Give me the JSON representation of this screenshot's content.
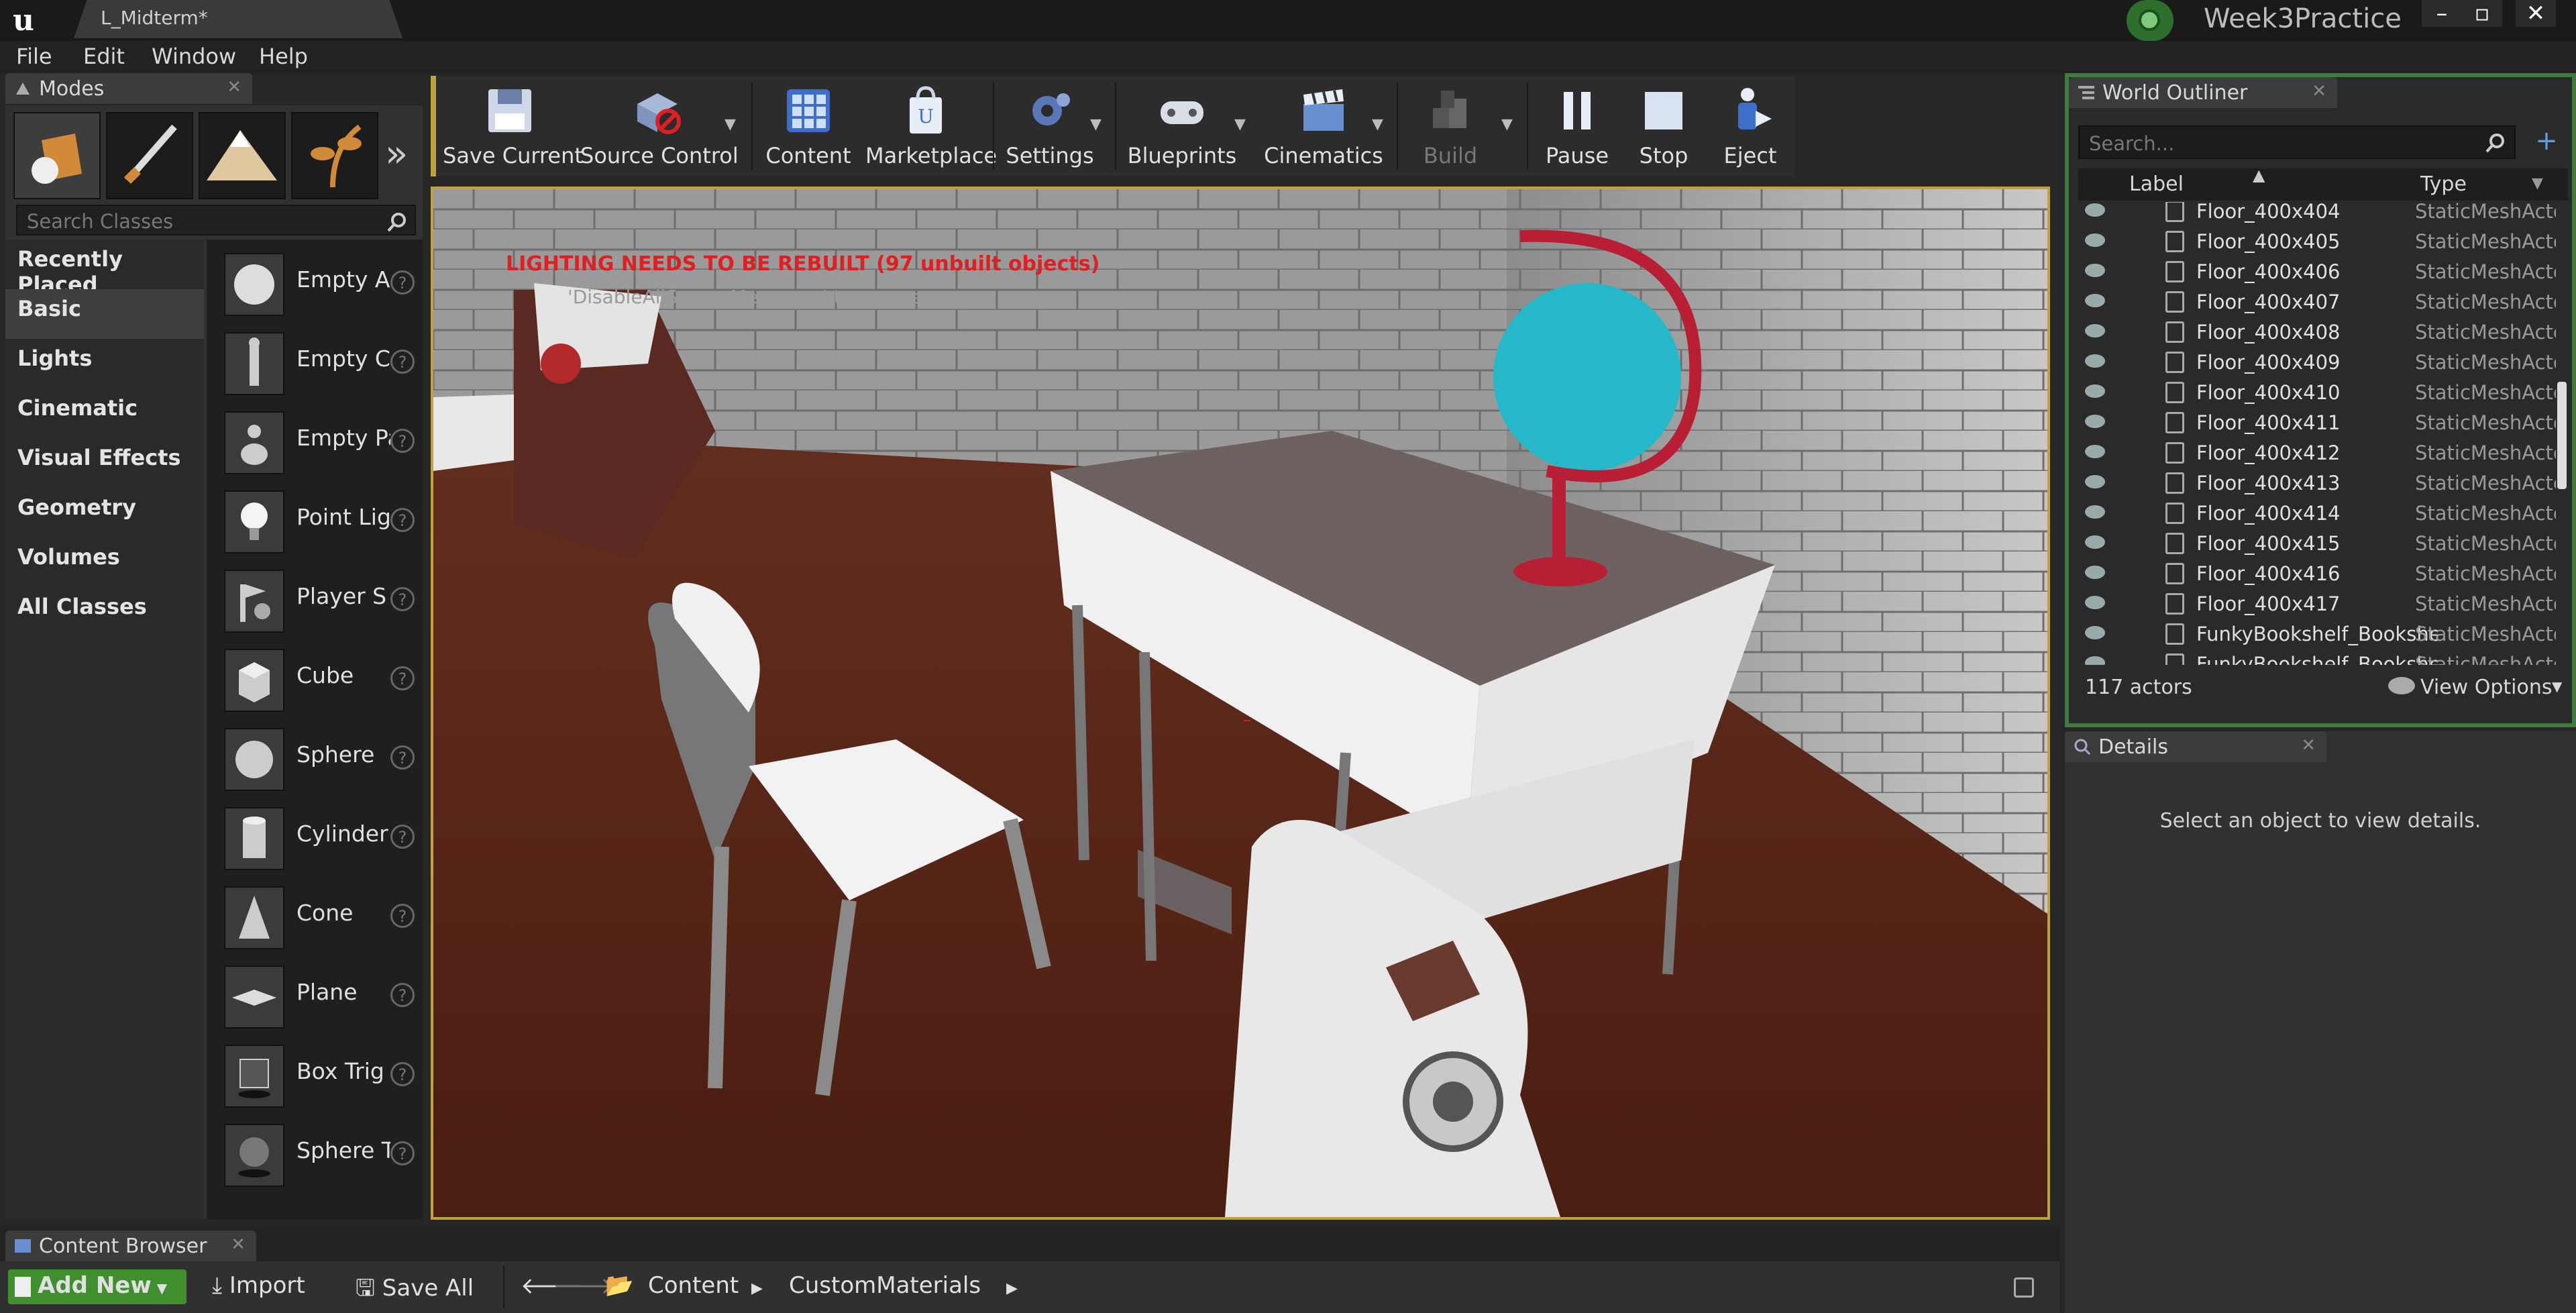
{
  "title_bar": {
    "document_tab": "L_Midterm*",
    "project_name": "Week3Practice",
    "window_buttons": [
      "–",
      "▫",
      "✕"
    ]
  },
  "menu": [
    "File",
    "Edit",
    "Window",
    "Help"
  ],
  "modes_panel": {
    "title": "Modes",
    "search_placeholder": "Search Classes",
    "categories": [
      "Recently Placed",
      "Basic",
      "Lights",
      "Cinematic",
      "Visual Effects",
      "Geometry",
      "Volumes",
      "All Classes"
    ],
    "active_category": "Basic",
    "items": [
      "Empty Ac",
      "Empty Ch",
      "Empty Pa",
      "Point Lig",
      "Player S",
      "Cube",
      "Sphere",
      "Cylinder",
      "Cone",
      "Plane",
      "Box Trig",
      "Sphere T"
    ]
  },
  "toolbar": {
    "buttons": [
      {
        "label": "Save Current",
        "icon": "save-icon"
      },
      {
        "label": "Source Control",
        "icon": "source-control-icon"
      },
      {
        "label": "Content",
        "icon": "content-icon"
      },
      {
        "label": "Marketplace",
        "icon": "marketplace-icon"
      },
      {
        "label": "Settings",
        "icon": "settings-icon"
      },
      {
        "label": "Blueprints",
        "icon": "blueprints-icon"
      },
      {
        "label": "Cinematics",
        "icon": "cinematics-icon"
      },
      {
        "label": "Build",
        "icon": "build-icon"
      },
      {
        "label": "Pause",
        "icon": "pause-icon"
      },
      {
        "label": "Stop",
        "icon": "stop-icon"
      },
      {
        "label": "Eject",
        "icon": "eject-icon"
      }
    ]
  },
  "viewport": {
    "warning": "LIGHTING NEEDS TO BE REBUILT (97 unbuilt objects)",
    "hint": "'DisableAllScreenMessages' to suppress"
  },
  "world_outliner": {
    "title": "World Outliner",
    "search_placeholder": "Search...",
    "col_label": "Label",
    "col_type": "Type",
    "rows": [
      {
        "label": "Floor_400x404",
        "type": "StaticMeshActor"
      },
      {
        "label": "Floor_400x405",
        "type": "StaticMeshActor"
      },
      {
        "label": "Floor_400x406",
        "type": "StaticMeshActor"
      },
      {
        "label": "Floor_400x407",
        "type": "StaticMeshActor"
      },
      {
        "label": "Floor_400x408",
        "type": "StaticMeshActor"
      },
      {
        "label": "Floor_400x409",
        "type": "StaticMeshActor"
      },
      {
        "label": "Floor_400x410",
        "type": "StaticMeshActor"
      },
      {
        "label": "Floor_400x411",
        "type": "StaticMeshActor"
      },
      {
        "label": "Floor_400x412",
        "type": "StaticMeshActor"
      },
      {
        "label": "Floor_400x413",
        "type": "StaticMeshActor"
      },
      {
        "label": "Floor_400x414",
        "type": "StaticMeshActor"
      },
      {
        "label": "Floor_400x415",
        "type": "StaticMeshActor"
      },
      {
        "label": "Floor_400x416",
        "type": "StaticMeshActor"
      },
      {
        "label": "Floor_400x417",
        "type": "StaticMeshActor"
      },
      {
        "label": "FunkyBookshelf_Bookshelf",
        "type": "StaticMeshActor"
      },
      {
        "label": "FunkyBookshelf_Bookshelf",
        "type": "StaticMeshActor"
      }
    ],
    "actor_count": "117 actors",
    "view_options": "View Options"
  },
  "details": {
    "title": "Details",
    "empty_message": "Select an object to view details."
  },
  "content_browser": {
    "title": "Content Browser",
    "add_new": "Add New",
    "import": "Import",
    "save_all": "Save All",
    "path": [
      "Content",
      "CustomMaterials"
    ]
  },
  "colors": {
    "accent_yellow": "#bfa23e",
    "outliner_border": "#3f7a3f",
    "add_new_green": "#3f8f2f",
    "warning_red": "#e02020"
  }
}
